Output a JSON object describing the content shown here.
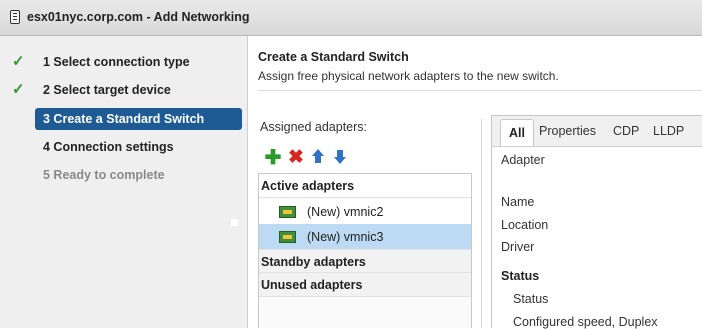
{
  "window": {
    "title": "esx01nyc.corp.com - Add Networking"
  },
  "wizard": {
    "steps": [
      {
        "label": "1 Select connection type",
        "state": "done"
      },
      {
        "label": "2 Select target device",
        "state": "done"
      },
      {
        "label": "3 Create a Standard Switch",
        "state": "current"
      },
      {
        "label": "4 Connection settings",
        "state": "pending"
      },
      {
        "label": "5 Ready to complete",
        "state": "disabled"
      }
    ]
  },
  "main": {
    "heading": "Create a Standard Switch",
    "subheading": "Assign free physical network adapters to the new switch.",
    "assigned_label": "Assigned adapters:",
    "toolbar_icons": [
      "add-icon",
      "remove-icon",
      "move-up-icon",
      "move-down-icon"
    ],
    "groups": {
      "active": "Active adapters",
      "standby": "Standby adapters",
      "unused": "Unused adapters"
    },
    "adapters": [
      {
        "label": "(New) vmnic2",
        "selected": false
      },
      {
        "label": "(New) vmnic3",
        "selected": true
      }
    ]
  },
  "details": {
    "tabs": [
      "All",
      "Properties",
      "CDP",
      "LLDP"
    ],
    "active_tab": "All",
    "adapter_label": "Adapter",
    "fields": [
      "Name",
      "Location",
      "Driver"
    ],
    "status_heading": "Status",
    "status_fields": [
      "Status",
      "Configured speed, Duplex"
    ]
  },
  "colors": {
    "current_step_bg": "#1e5b94",
    "selected_row_bg": "#bcdaf3",
    "check_green": "#2e9a2e",
    "add_green": "#2a9a2a",
    "remove_red": "#d8261e",
    "arrow_blue": "#2f72c8"
  }
}
